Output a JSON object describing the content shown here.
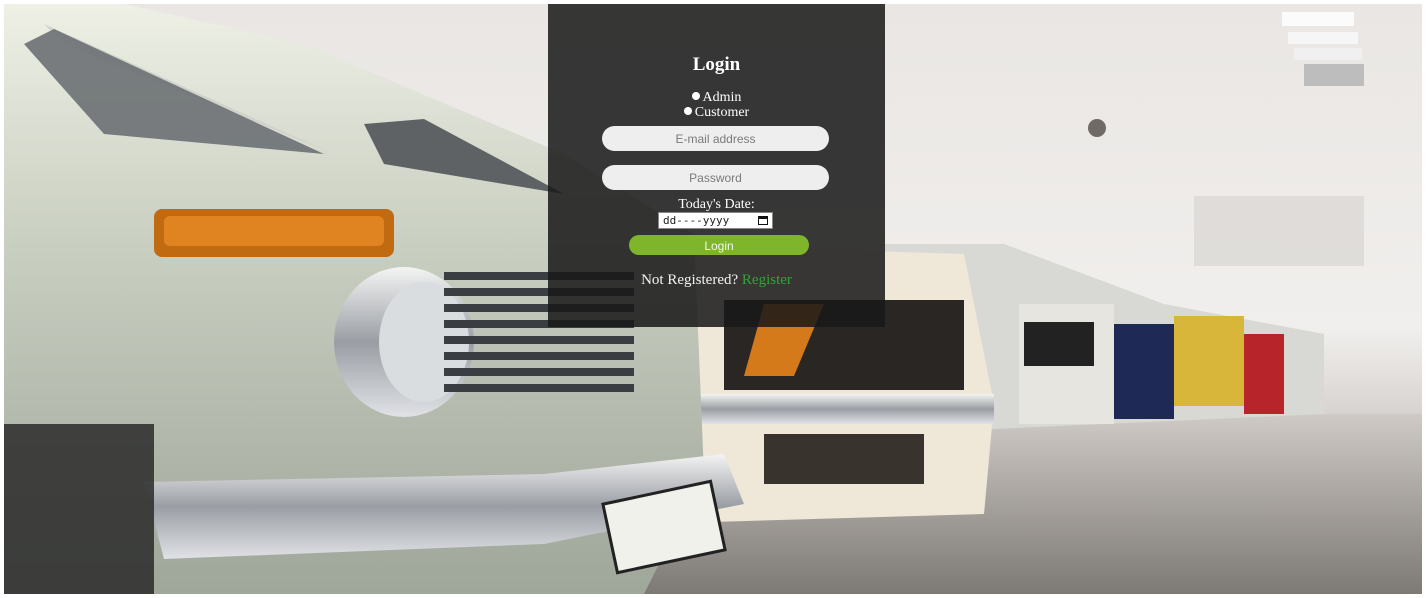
{
  "login": {
    "title": "Login",
    "roles": [
      {
        "label": "Admin"
      },
      {
        "label": "Customer"
      }
    ],
    "email_placeholder": "E-mail address",
    "password_placeholder": "Password",
    "date_label": "Today's Date:",
    "date_value": "dd----yyyy",
    "submit_label": "Login",
    "not_registered_text": "Not Registered?",
    "register_link": "Register"
  },
  "colors": {
    "panel": "#191919",
    "button": "#7fb52a",
    "link": "#34a33a"
  },
  "icons": {
    "radio": "radio-dot-icon",
    "calendar": "calendar-icon"
  }
}
